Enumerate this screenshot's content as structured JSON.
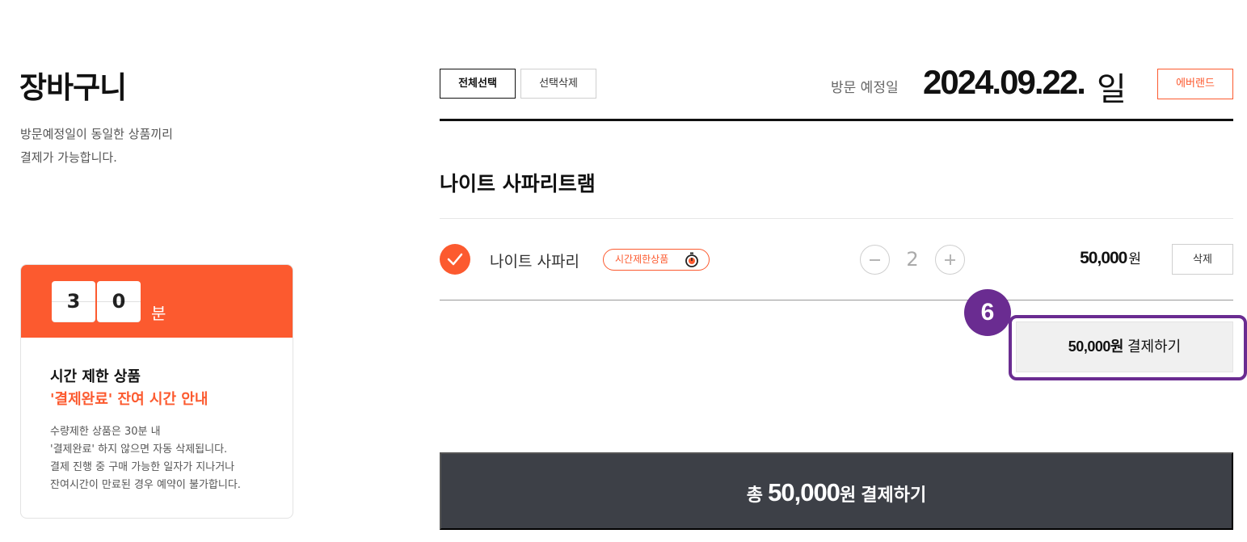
{
  "cart": {
    "title": "장바구니",
    "desc_line1": "방문예정일이 동일한 상품끼리",
    "desc_line2": "결제가 가능합니다."
  },
  "timer": {
    "digit1": "3",
    "digit2": "0",
    "unit": "분",
    "title": "시간 제한 상품",
    "title_accent": "'결제완료' 잔여 시간 안내",
    "notes": [
      "수량제한 상품은 30분 내",
      "'결제완료' 하지 않으면 자동 삭제됩니다.",
      "결제 진행 중 구매 가능한 일자가 지나거나",
      "잔여시간이 만료된 경우 예약이 불가합니다."
    ]
  },
  "toolbar": {
    "select_all": "전체선택",
    "delete_selected": "선택삭제"
  },
  "visit": {
    "label": "방문 예정일",
    "date": "2024.09.22.",
    "day": "일",
    "park": "에버랜드"
  },
  "section": {
    "title": "나이트 사파리트램"
  },
  "item": {
    "checked": true,
    "name": "나이트 사파리",
    "badge": "시간제한상품",
    "quantity": "2",
    "price": "50,000",
    "currency": "원",
    "delete_label": "삭제"
  },
  "group_pay": {
    "amount": "50,000원",
    "label": "결제하기"
  },
  "step_marker": "6",
  "total": {
    "prefix": "총",
    "amount": "50,000",
    "suffix": "원 결제하기"
  },
  "colors": {
    "accent": "#fc5a2f",
    "dark_button": "#3d4047",
    "highlight": "#6a2c91"
  },
  "icons": [
    "check-icon",
    "stopwatch-icon",
    "minus-icon",
    "plus-icon"
  ]
}
